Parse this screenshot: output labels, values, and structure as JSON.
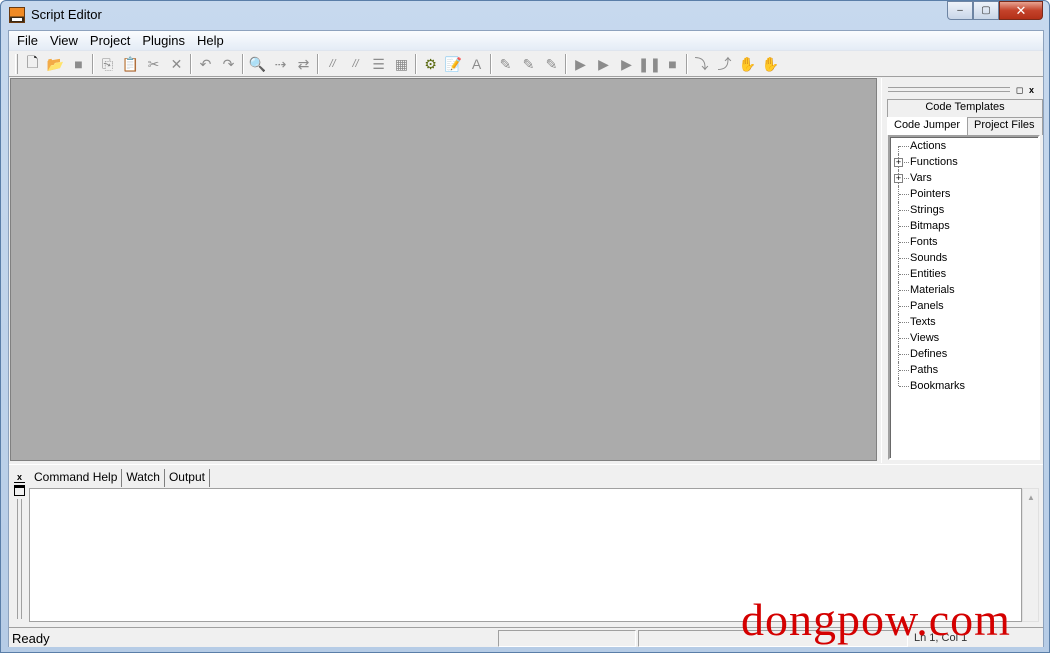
{
  "window": {
    "title": "Script Editor",
    "minimize_label": "‒",
    "maximize_label": "▢",
    "close_label": "✕"
  },
  "menubar": {
    "items": [
      "File",
      "View",
      "Project",
      "Plugins",
      "Help"
    ]
  },
  "toolbar": {
    "buttons": [
      {
        "name": "new-file",
        "glyph": "🗋",
        "enabled": true
      },
      {
        "name": "open-file",
        "glyph": "📂",
        "enabled": true
      },
      {
        "name": "save-file",
        "glyph": "■",
        "enabled": false
      },
      {
        "name": "copy",
        "glyph": "⎘",
        "enabled": false
      },
      {
        "name": "paste",
        "glyph": "📋",
        "enabled": false
      },
      {
        "name": "cut",
        "glyph": "✂",
        "enabled": false
      },
      {
        "name": "delete",
        "glyph": "✕",
        "enabled": false
      },
      {
        "name": "undo",
        "glyph": "↶",
        "enabled": false
      },
      {
        "name": "redo",
        "glyph": "↷",
        "enabled": false
      },
      {
        "name": "find",
        "glyph": "🔍",
        "enabled": false
      },
      {
        "name": "find-next",
        "glyph": "⇢",
        "enabled": false
      },
      {
        "name": "replace",
        "glyph": "⇄",
        "enabled": false
      },
      {
        "name": "comment",
        "glyph": "//",
        "enabled": false
      },
      {
        "name": "uncomment",
        "glyph": "//",
        "enabled": false
      },
      {
        "name": "indent",
        "glyph": "☰",
        "enabled": false
      },
      {
        "name": "format",
        "glyph": "▦",
        "enabled": false
      },
      {
        "name": "compile",
        "glyph": "⚙",
        "enabled": true
      },
      {
        "name": "properties",
        "glyph": "📝",
        "enabled": true
      },
      {
        "name": "font",
        "glyph": "A",
        "enabled": false
      },
      {
        "name": "breakpoint",
        "glyph": "✎",
        "enabled": false
      },
      {
        "name": "breakpoint-add",
        "glyph": "✎",
        "enabled": false
      },
      {
        "name": "breakpoint-clear",
        "glyph": "✎",
        "enabled": false
      },
      {
        "name": "run",
        "glyph": "▶",
        "enabled": false
      },
      {
        "name": "step",
        "glyph": "▶",
        "enabled": false
      },
      {
        "name": "step-over",
        "glyph": "▶",
        "enabled": false
      },
      {
        "name": "pause",
        "glyph": "❚❚",
        "enabled": false
      },
      {
        "name": "stop",
        "glyph": "■",
        "enabled": false
      },
      {
        "name": "step-into",
        "glyph": "⤵",
        "enabled": false
      },
      {
        "name": "step-out",
        "glyph": "⤴",
        "enabled": false
      },
      {
        "name": "hand",
        "glyph": "✋",
        "enabled": false
      },
      {
        "name": "hand-all",
        "glyph": "✋",
        "enabled": false
      }
    ]
  },
  "right_panel": {
    "tabs_top": [
      "Code Templates"
    ],
    "tabs_bottom": [
      "Code Jumper",
      "Project Files"
    ],
    "selected_tab": "Code Jumper",
    "tree": [
      {
        "label": "Actions",
        "expandable": false
      },
      {
        "label": "Functions",
        "expandable": true
      },
      {
        "label": "Vars",
        "expandable": true
      },
      {
        "label": "Pointers",
        "expandable": false
      },
      {
        "label": "Strings",
        "expandable": false
      },
      {
        "label": "Bitmaps",
        "expandable": false
      },
      {
        "label": "Fonts",
        "expandable": false
      },
      {
        "label": "Sounds",
        "expandable": false
      },
      {
        "label": "Entities",
        "expandable": false
      },
      {
        "label": "Materials",
        "expandable": false
      },
      {
        "label": "Panels",
        "expandable": false
      },
      {
        "label": "Texts",
        "expandable": false
      },
      {
        "label": "Views",
        "expandable": false
      },
      {
        "label": "Defines",
        "expandable": false
      },
      {
        "label": "Paths",
        "expandable": false
      },
      {
        "label": "Bookmarks",
        "expandable": false
      }
    ]
  },
  "bottom_panel": {
    "tabs": [
      "Command Help",
      "Watch",
      "Output"
    ],
    "selected_tab": "Command Help"
  },
  "statusbar": {
    "text": "Ready",
    "position": "Ln 1, Col 1"
  },
  "watermark": "dongpow.com"
}
